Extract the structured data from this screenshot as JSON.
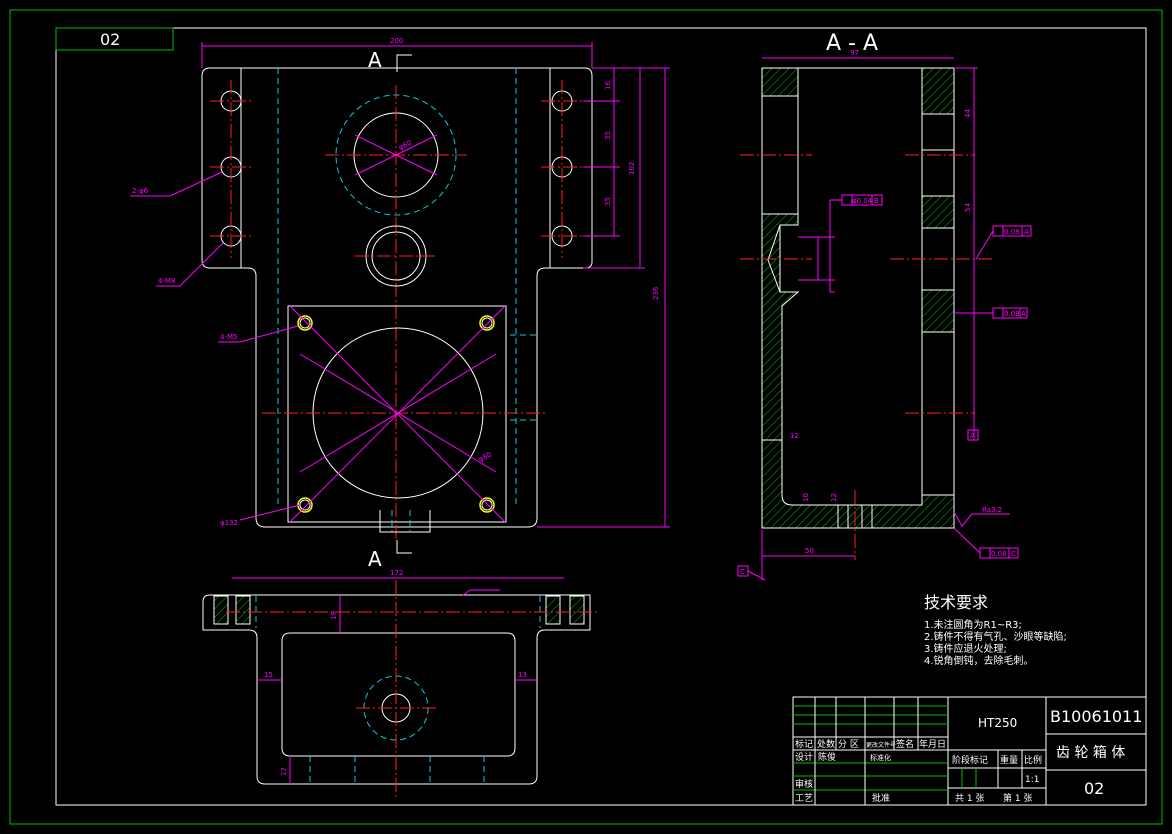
{
  "drawing": {
    "sheet_tag": "02",
    "section_title": "A - A",
    "section_marks": [
      "A",
      "A"
    ],
    "material": "HT250",
    "drawing_number": "B10061011",
    "part_name": "齿 轮 箱 体",
    "sheet_code": "02",
    "scale": "1:1",
    "sheets_total": "共 1 张",
    "sheet_index": "第 1 张"
  },
  "title_block": {
    "row_labels": [
      "标记",
      "处数",
      "分 区",
      "更改文件号",
      "签名",
      "年月日"
    ],
    "design_label": "设计",
    "designer": "陈俊",
    "standard_label": "标准化",
    "stage_label": "阶段标记",
    "weight_label": "重量",
    "scale_label": "比例",
    "review_label": "审核",
    "process_label": "工艺",
    "approve_label": "批准"
  },
  "tech_requirements": {
    "title": "技术要求",
    "items": [
      "1.未注圆角为R1~R3;",
      "2.铸件不得有气孔、沙眼等缺陷;",
      "3.铸件应退火处理;",
      "4.锐角倒钝，去除毛刺。"
    ]
  },
  "dimensions": {
    "top_width": "200",
    "height_total": "236",
    "height_102": "102",
    "d16": "16",
    "d35a": "35",
    "d35b": "35",
    "holes_2": "2-φ6",
    "holes_4a": "4-M8",
    "holes_4b": "4-M5",
    "dia_132": "φ132",
    "dia_80": "φ80",
    "dia_60": "φ60",
    "sec_width": "97",
    "sec_44": "44",
    "sec_54": "54",
    "sec_12": "12",
    "sec_50": "50",
    "sec_10": "10",
    "sec_12b": "12",
    "bottom_width": "172",
    "b19": "19",
    "b15": "15",
    "b13": "13",
    "b17": "17",
    "tol1": "0.08",
    "tol1_ref": "A",
    "tol2": "0.08",
    "tol2_ref": "A",
    "tol3": "0.08",
    "tol3_ref": "C",
    "tol4": "φ0.04",
    "tol4_ref": "B",
    "datum_a": "A",
    "datum_c": "C",
    "rough": "Ra3.2"
  },
  "colors": {
    "background": "#000000",
    "outline": "#ffffff",
    "frame": "#00c000",
    "center": "#ff2020",
    "hidden": "#00d0e0",
    "dimension": "#ff00ff",
    "hatch": "#00c000"
  }
}
